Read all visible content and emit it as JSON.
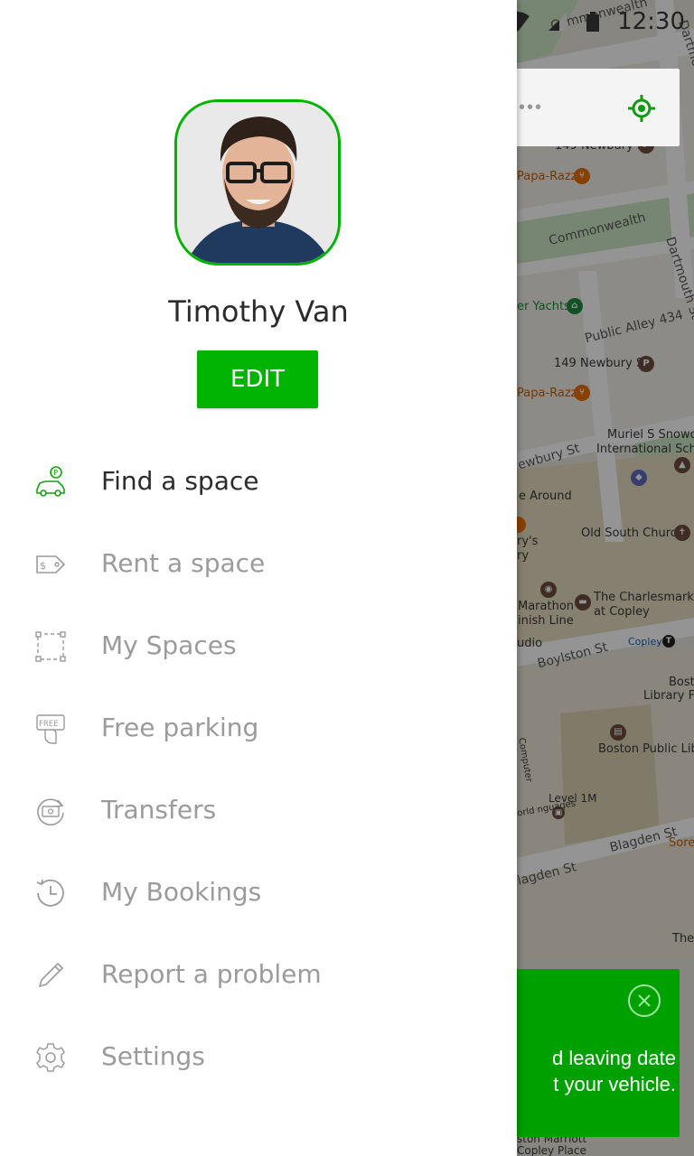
{
  "status_bar": {
    "time": "12:30"
  },
  "profile": {
    "name": "Timothy Van",
    "edit_label": "EDIT"
  },
  "menu": {
    "items": [
      {
        "label": "Find a space",
        "icon": "car-parking-icon",
        "active": true
      },
      {
        "label": "Rent a space",
        "icon": "price-tag-icon",
        "active": false
      },
      {
        "label": "My Spaces",
        "icon": "spaces-grid-icon",
        "active": false
      },
      {
        "label": "Free parking",
        "icon": "free-parking-icon",
        "active": false
      },
      {
        "label": "Transfers",
        "icon": "transfer-icon",
        "active": false
      },
      {
        "label": "My Bookings",
        "icon": "history-clock-icon",
        "active": false
      },
      {
        "label": "Report a problem",
        "icon": "pencil-icon",
        "active": false
      },
      {
        "label": "Settings",
        "icon": "gear-icon",
        "active": false
      }
    ]
  },
  "map": {
    "labels": {
      "commonwealth_top": "Commonwealth",
      "dartmouth_top": "Dartmouth St",
      "newbury_149_top": "149 Newbury St",
      "paparazzi_top": "Papa-Razzi",
      "commonwealth_mid": "Commonwealth",
      "dartmouth_mid": "Dartmouth St",
      "yachts": "er Yachts",
      "public_alley": "Public Alley 434",
      "newbury_149": "149 Newbury St",
      "paparazzi": "Papa-Razzi",
      "muriel": "Muriel S Snowde",
      "intl_school": "International Schoo",
      "newbury_st": "ewbury St",
      "around": "e Around",
      "old_south": "Old South Church",
      "rys": "ry's",
      "ry": "ry",
      "marathon": "Marathon",
      "finish_line": "inish Line",
      "charlesmark": "The Charlesmark",
      "at_copley": "at Copley",
      "udio": "udio",
      "boylston": "Boylston St",
      "copley": "Copley",
      "bost": "Bost",
      "library_fo": "Library Fo",
      "boston_public": "Boston Public Libr",
      "computer": "Computer",
      "level_1m": "Level 1M",
      "languages": "orld nguages",
      "blagden_1": "Blagden St",
      "blagden_2": "lagden St",
      "sorel": "Sorel",
      "the": "The",
      "marriott": "ston Marriott",
      "copley_place": "Copley Place"
    }
  },
  "snackbar": {
    "text": "d leaving date\nt your vehicle."
  },
  "colors": {
    "accent": "#00b300",
    "snackbar": "#00a000",
    "text_active": "#2b2b2b",
    "text_muted": "#9b9b9b"
  }
}
